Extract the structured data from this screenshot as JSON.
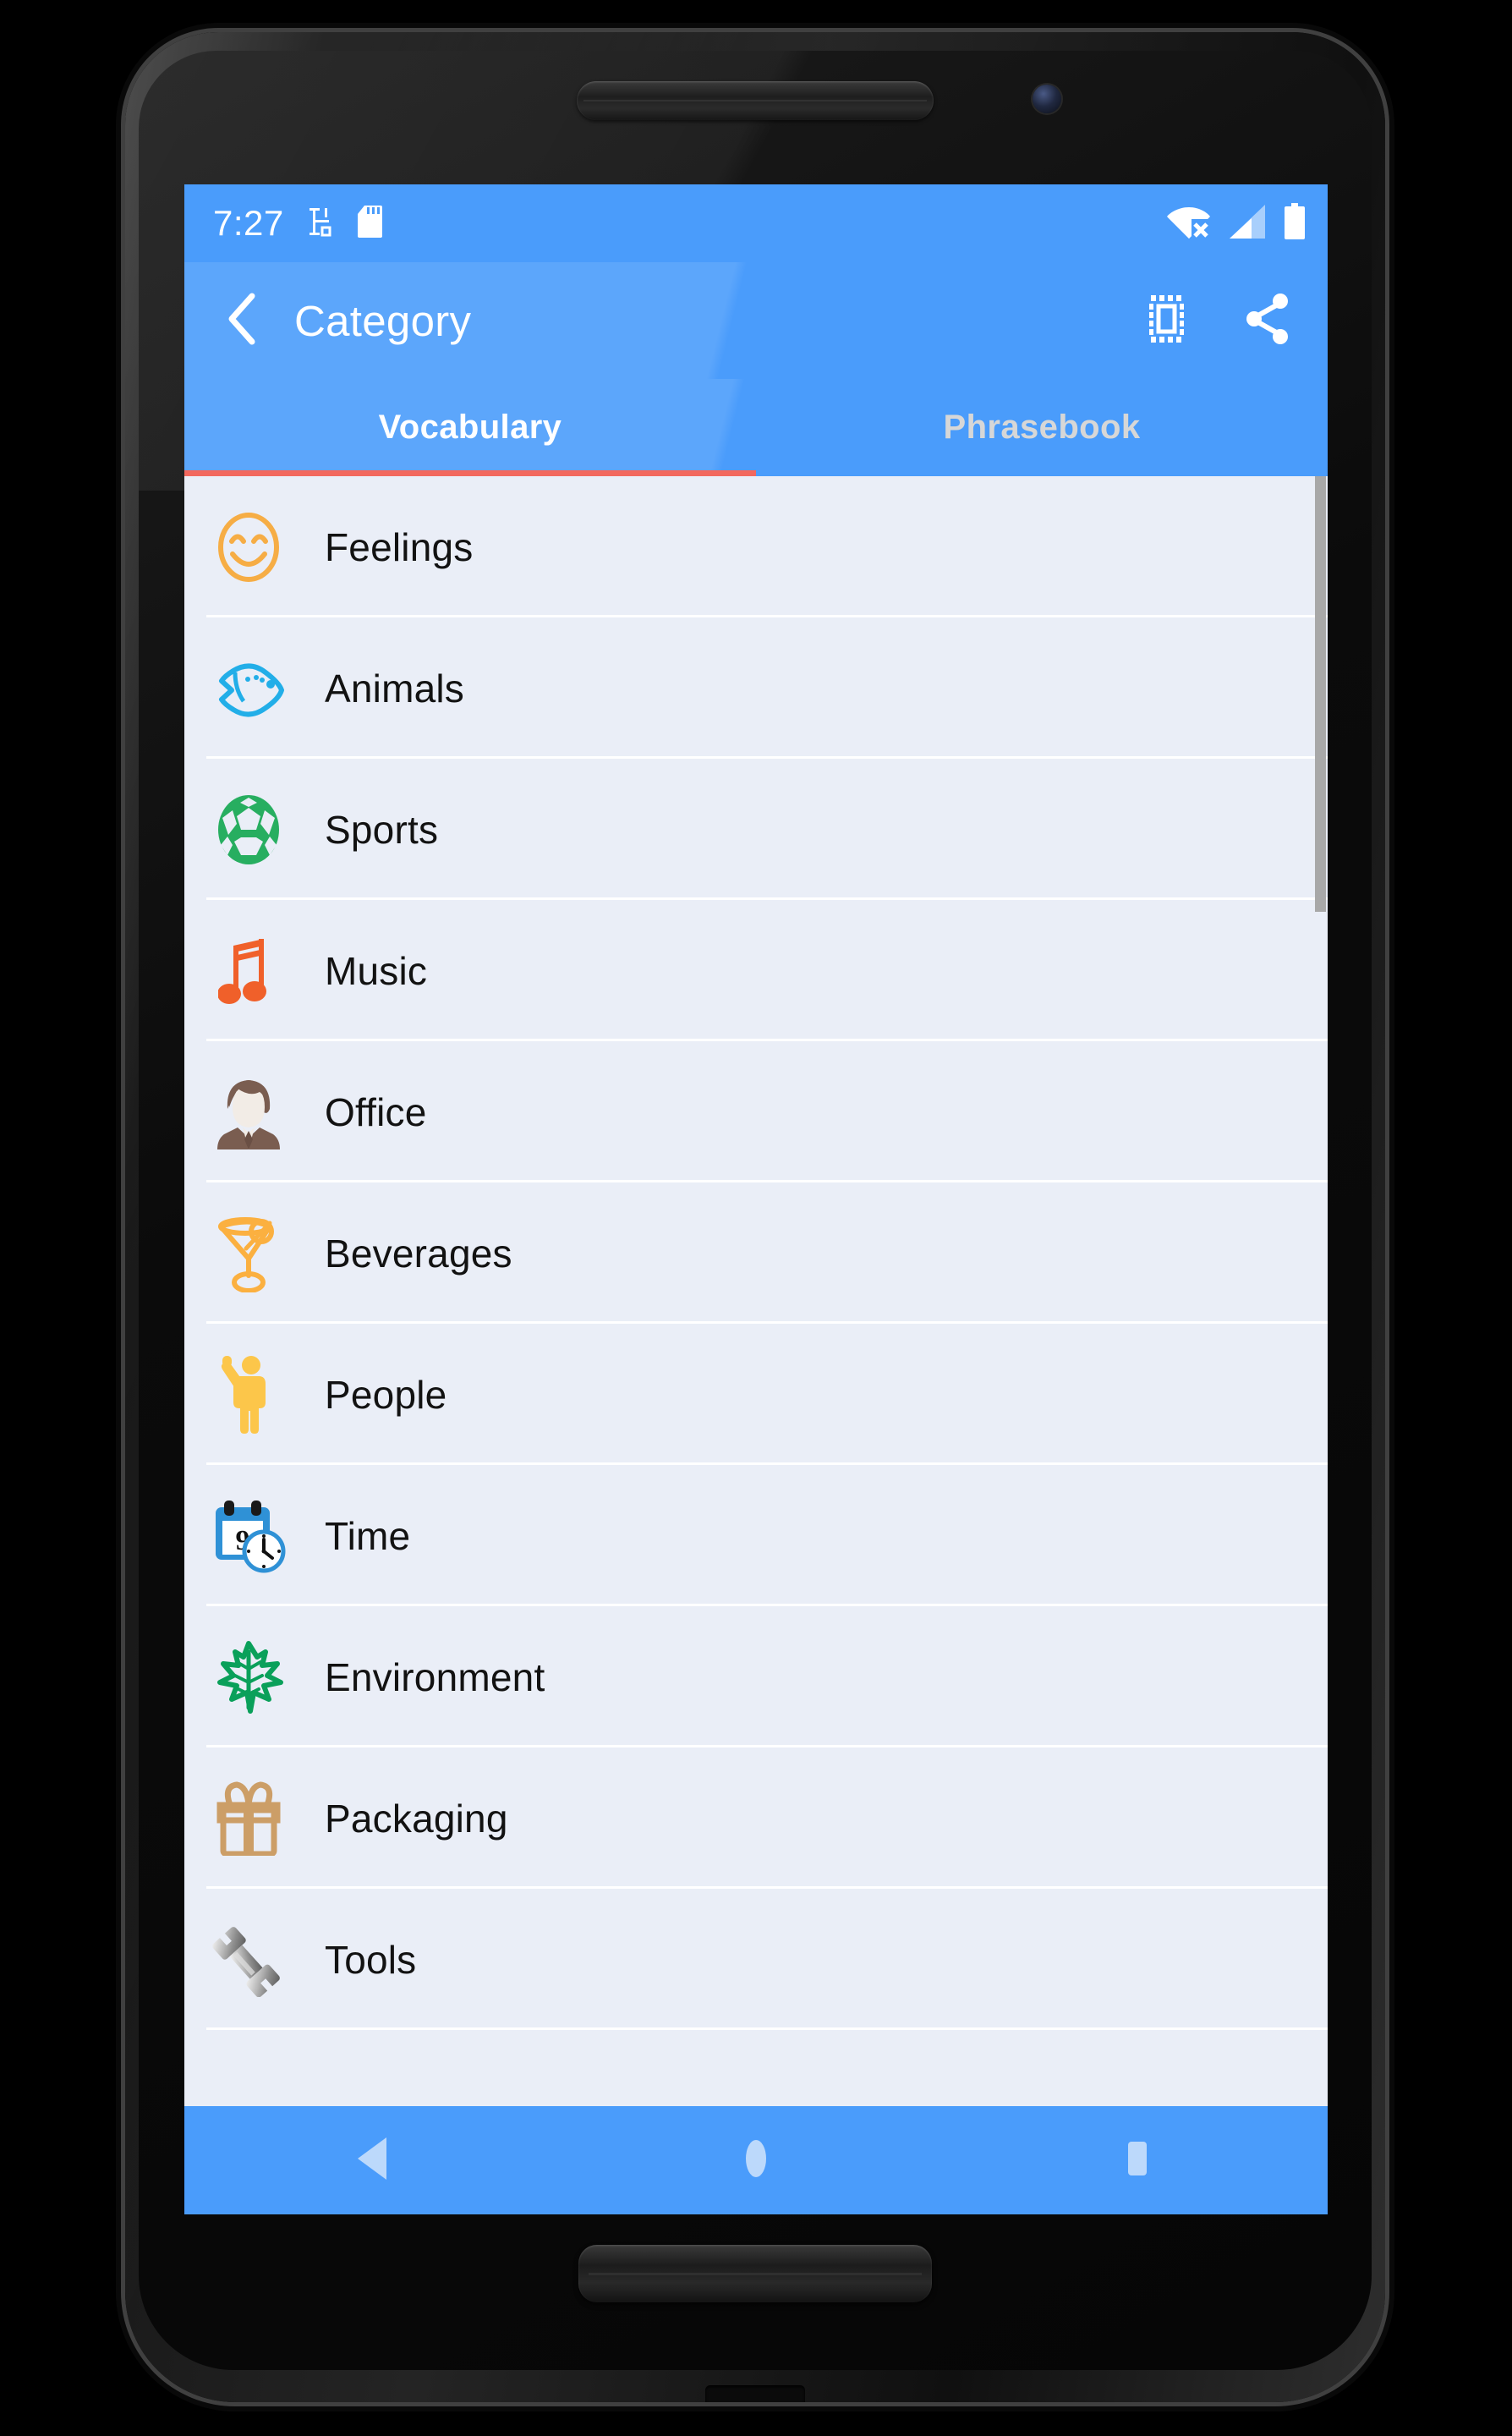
{
  "device": {
    "model_frame": "android-phone",
    "earpiece": "earpiece-speaker",
    "camera": "front-camera"
  },
  "status_bar": {
    "time": "7:27",
    "icons": [
      {
        "name": "vibrate-icon",
        "label": "vibrate"
      },
      {
        "name": "sd-card-icon",
        "label": "sd-card"
      }
    ],
    "right_icons": [
      {
        "name": "wifi-off-icon",
        "label": "wifi-disconnected"
      },
      {
        "name": "cellular-signal-icon",
        "label": "cellular-signal"
      },
      {
        "name": "battery-icon",
        "label": "battery-full"
      }
    ],
    "background": "#4a9cfb"
  },
  "toolbar": {
    "back_icon": "back-chevron-icon",
    "title": "Category",
    "actions": [
      {
        "name": "select-all-icon",
        "label": "Select all"
      },
      {
        "name": "share-icon",
        "label": "Share"
      }
    ],
    "background": "#4a9cfb",
    "title_color": "#ffffff"
  },
  "tabs": {
    "items": [
      {
        "label": "Vocabulary",
        "active": true
      },
      {
        "label": "Phrasebook",
        "active": false
      }
    ],
    "indicator_color": "#f2685e",
    "active_color": "#ffffff",
    "inactive_color": "#d7d7d7"
  },
  "list": {
    "background": "#eaeef7",
    "divider_color": "#ffffff",
    "scrollbar_color": "#a8a8a8",
    "items": [
      {
        "label": "Feelings",
        "icon": "smiley-face-icon",
        "color": "#f6ad45"
      },
      {
        "label": "Animals",
        "icon": "fish-icon",
        "color": "#22aee8"
      },
      {
        "label": "Sports",
        "icon": "soccer-ball-icon",
        "color": "#27ae60"
      },
      {
        "label": "Music",
        "icon": "music-note-icon",
        "color": "#f0602a"
      },
      {
        "label": "Office",
        "icon": "businessman-icon",
        "color": "#7a5d50"
      },
      {
        "label": "Beverages",
        "icon": "cocktail-glass-icon",
        "color": "#fbb040"
      },
      {
        "label": "People",
        "icon": "person-waving-icon",
        "color": "#fcc64a"
      },
      {
        "label": "Time",
        "icon": "calendar-clock-icon",
        "color": "#2f91d6"
      },
      {
        "label": "Environment",
        "icon": "leaf-icon",
        "color": "#0aa05a"
      },
      {
        "label": "Packaging",
        "icon": "gift-box-icon",
        "color": "#cc9e67"
      },
      {
        "label": "Tools",
        "icon": "wrench-icon",
        "color": "#9a9a9a"
      }
    ]
  },
  "nav_bar": {
    "background": "#4a9cfb",
    "icon_color": "#bcd9fb",
    "buttons": [
      {
        "name": "nav-back-button",
        "label": "Back"
      },
      {
        "name": "nav-home-button",
        "label": "Home"
      },
      {
        "name": "nav-recents-button",
        "label": "Recents"
      }
    ]
  }
}
